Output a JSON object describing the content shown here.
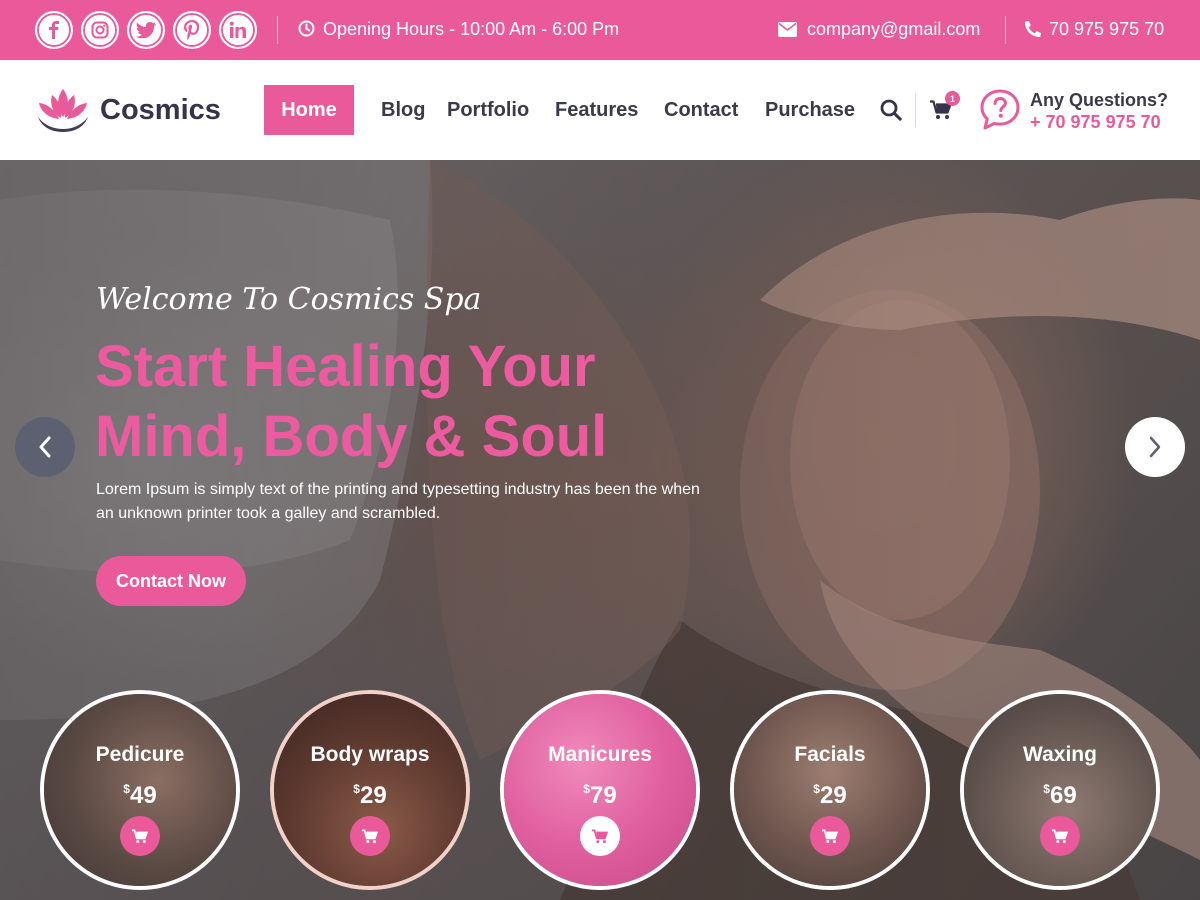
{
  "topbar": {
    "social": [
      {
        "icon": "facebook-icon"
      },
      {
        "icon": "instagram-icon"
      },
      {
        "icon": "twitter-icon"
      },
      {
        "icon": "pinterest-icon"
      },
      {
        "icon": "linkedin-icon"
      }
    ],
    "hours": "Opening Hours - 10:00 Am - 6:00 Pm",
    "email": "company@gmail.com",
    "phone": "70 975 975 70"
  },
  "header": {
    "brand": "Cosmics",
    "nav": {
      "home": "Home",
      "blog": "Blog",
      "portfolio": "Portfolio",
      "features": "Features",
      "contact": "Contact",
      "purchase": "Purchase"
    },
    "cart_count": "1",
    "questions_title": "Any Questions?",
    "questions_phone": "+ 70 975 975 70"
  },
  "hero": {
    "welcome": "Welcome To Cosmics Spa",
    "headline_line1": "Start Healing Your",
    "headline_line2": "Mind, Body & Soul",
    "description": "Lorem Ipsum is simply text of the printing and typesetting industry has been the when an unknown printer took a galley and scrambled.",
    "cta_label": "Contact Now"
  },
  "services": [
    {
      "name": "Pedicure",
      "currency": "$",
      "price": "49"
    },
    {
      "name": "Body wraps",
      "currency": "$",
      "price": "29"
    },
    {
      "name": "Manicures",
      "currency": "$",
      "price": "79"
    },
    {
      "name": "Facials",
      "currency": "$",
      "price": "29"
    },
    {
      "name": "Waxing",
      "currency": "$",
      "price": "69"
    }
  ],
  "colors": {
    "accent": "#ea5a9b",
    "dark_text": "#3a3a4a",
    "white": "#ffffff"
  }
}
